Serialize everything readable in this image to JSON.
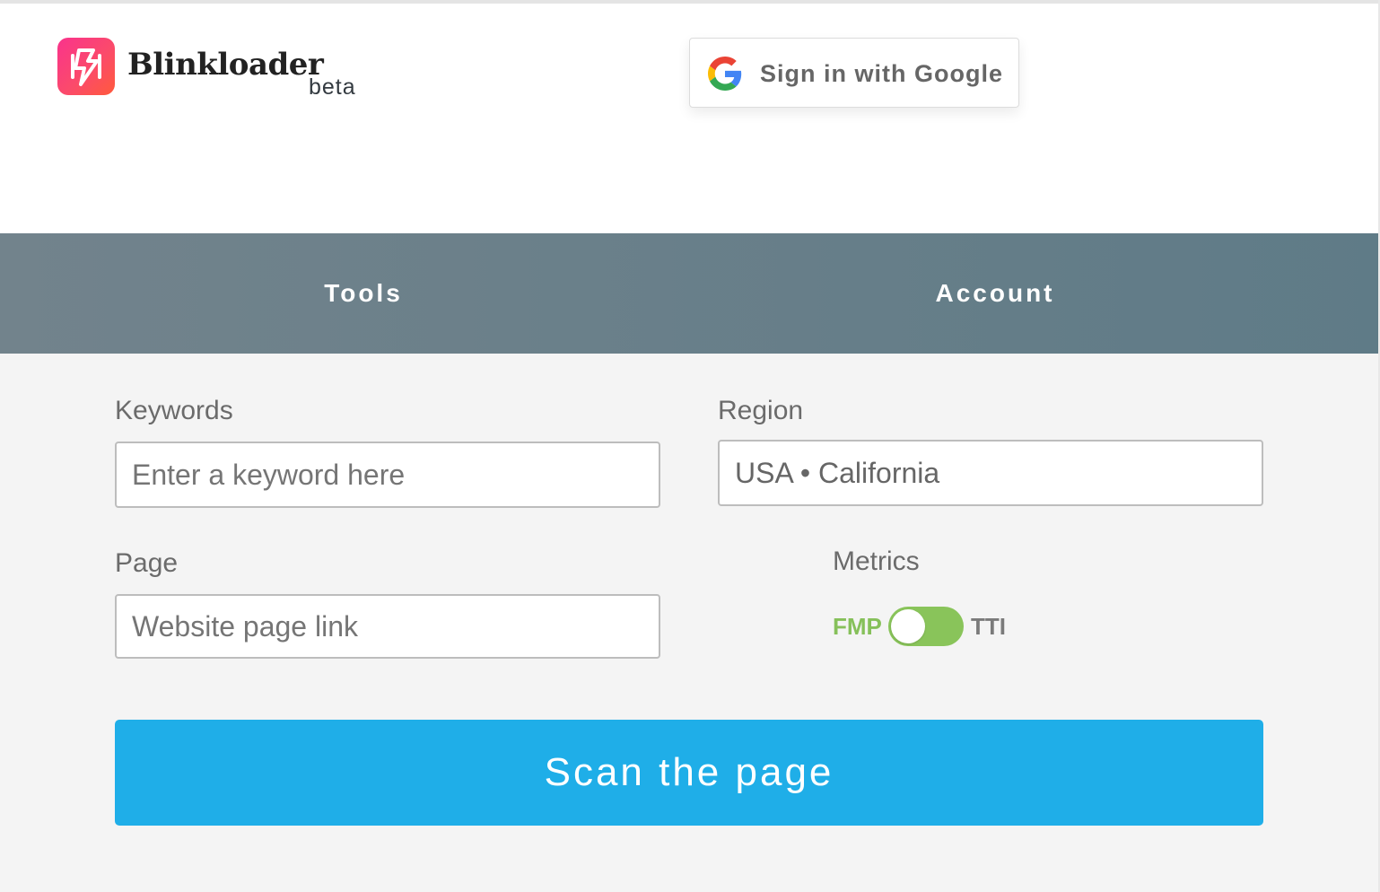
{
  "header": {
    "brand_name": "Blinkloader",
    "brand_tag": "beta",
    "logo_icon": "lightning-bolt-icon",
    "google_signin_label": "Sign in with Google",
    "google_icon": "google-g-icon"
  },
  "nav": {
    "items": [
      {
        "label": "Tools"
      },
      {
        "label": "Account"
      }
    ],
    "gradient_colors": [
      "#72838c",
      "#5f7b87"
    ]
  },
  "form": {
    "keywords": {
      "label": "Keywords",
      "placeholder": "Enter a keyword here"
    },
    "region": {
      "label": "Region",
      "value": "USA • California"
    },
    "page": {
      "label": "Page",
      "placeholder": "Website page link"
    },
    "metrics": {
      "label": "Metrics",
      "left_option": "FMP",
      "right_option": "TTI",
      "selected": "FMP"
    },
    "scan_button_label": "Scan the page"
  },
  "colors": {
    "accent_blue": "#1faee8",
    "toggle_green": "#89c45a",
    "logo_gradient": [
      "#f9338c",
      "#ff5a3c"
    ]
  }
}
